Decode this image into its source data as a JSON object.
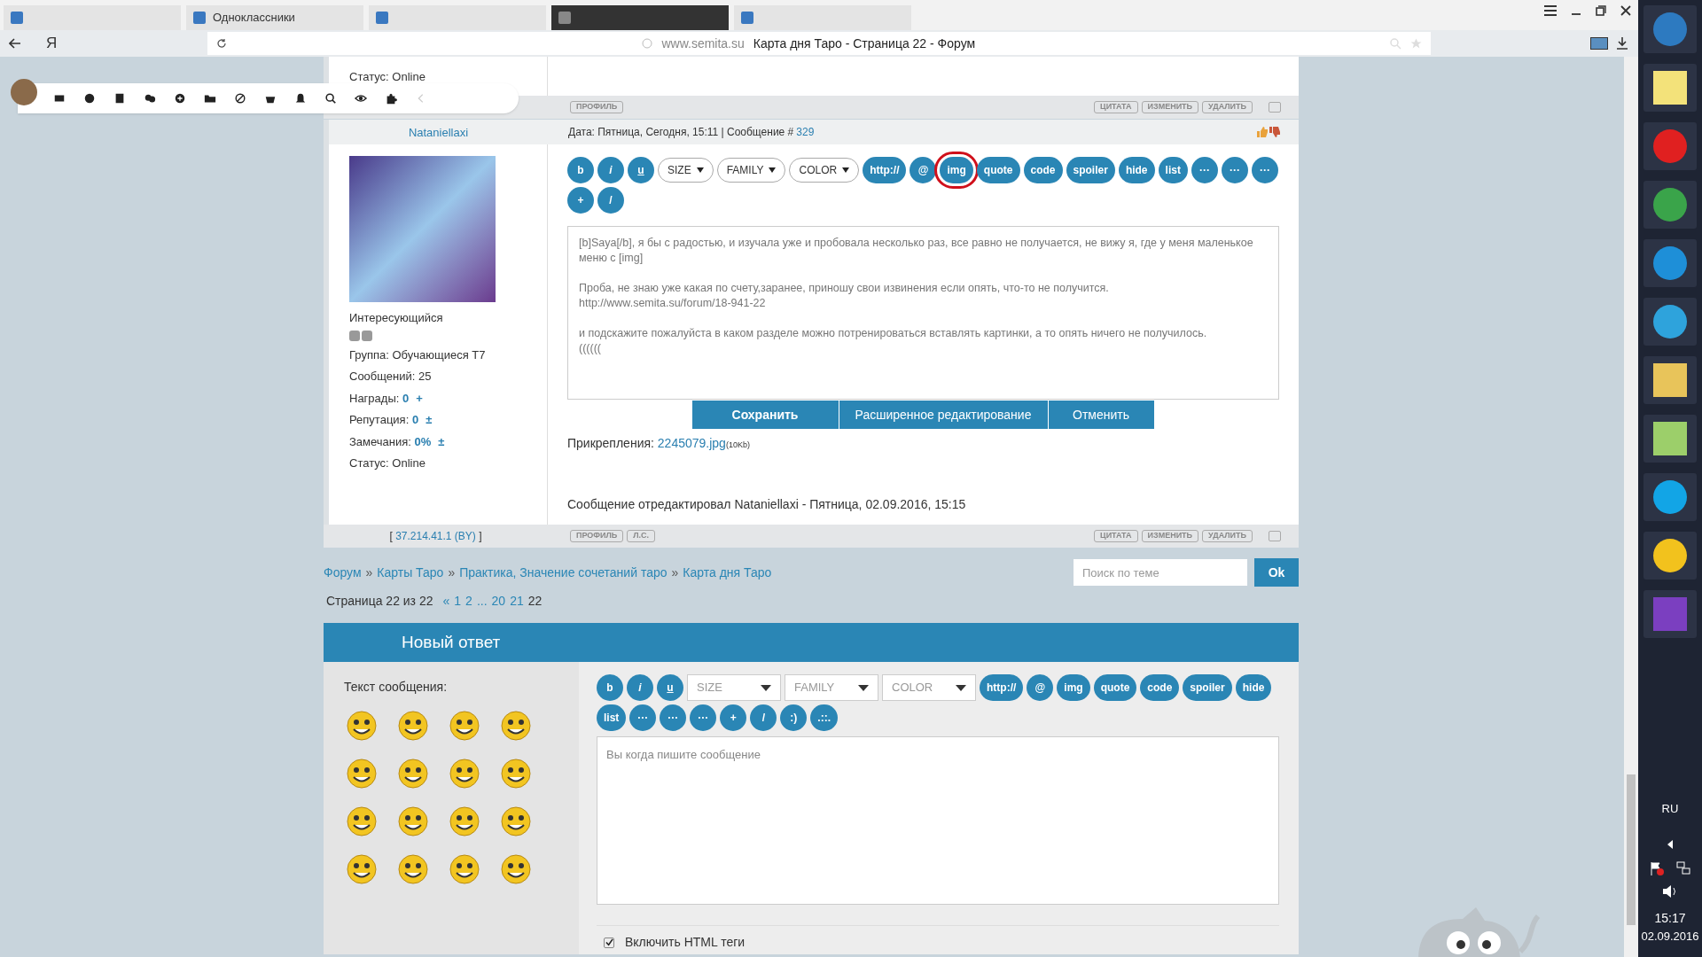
{
  "browser": {
    "tabs": [
      {
        "selected": false
      },
      {
        "label": "Одноклассники",
        "selected": false
      },
      {
        "selected": false
      },
      {
        "selected": true
      },
      {
        "selected": false
      }
    ],
    "logo": "Я",
    "url": "www.semita.su",
    "page_title": "Карта дня Таро - Страница 22 - Форум"
  },
  "previous_post": {
    "status": "Статус: Online",
    "footer_left": [
      "ПРОФИЛЬ"
    ],
    "footer_right": [
      "ЦИТАТА",
      "ИЗМЕНИТЬ",
      "УДАЛИТЬ"
    ]
  },
  "post": {
    "author": "Nataniellaxi",
    "date": "Дата: Пятница, Сегодня, 15:11 | Сообщение # ",
    "number": "329",
    "rank": "Интересующийся",
    "stats": [
      {
        "label": "Группа: ",
        "value": "Обучающиеся Т7",
        "kind": "plain"
      },
      {
        "label": "Сообщений: ",
        "value": "25",
        "kind": "plain"
      },
      {
        "label": "Награды: ",
        "value": "0",
        "kind": "link",
        "action": "+"
      },
      {
        "label": "Репутация: ",
        "value": "0",
        "kind": "link",
        "action": "±"
      },
      {
        "label": "Замечания: ",
        "value": "0%",
        "kind": "link",
        "action": "±"
      },
      {
        "label": "Статус: ",
        "value": "Online",
        "kind": "plain"
      }
    ],
    "toolbar": [
      {
        "label": "b",
        "kind": "button",
        "highlighted": false
      },
      {
        "label": "i",
        "kind": "button",
        "highlighted": false
      },
      {
        "label": "u",
        "kind": "button",
        "highlighted": false
      },
      {
        "label": "SIZE",
        "kind": "dropdown"
      },
      {
        "label": "FAMILY",
        "kind": "dropdown"
      },
      {
        "label": "COLOR",
        "kind": "dropdown"
      },
      {
        "label": "http://",
        "kind": "button",
        "highlighted": false
      },
      {
        "label": "@",
        "kind": "button",
        "highlighted": false
      },
      {
        "label": "img",
        "kind": "button",
        "highlighted": true
      },
      {
        "label": "quote",
        "kind": "button",
        "highlighted": false
      },
      {
        "label": "code",
        "kind": "button",
        "highlighted": false
      },
      {
        "label": "spoiler",
        "kind": "button",
        "highlighted": false
      },
      {
        "label": "hide",
        "kind": "button",
        "highlighted": false
      },
      {
        "label": "list",
        "kind": "button",
        "highlighted": false
      },
      {
        "label": "···",
        "kind": "button",
        "highlighted": false
      },
      {
        "label": "···",
        "kind": "button",
        "highlighted": false
      },
      {
        "label": "···",
        "kind": "button",
        "highlighted": false
      },
      {
        "label": "+",
        "kind": "button",
        "highlighted": false
      },
      {
        "label": "/",
        "kind": "button",
        "highlighted": false
      }
    ],
    "text": [
      "[b]Saya[/b], я бы с радостью, и изучала уже и пробовала несколько раз, все равно не получается, не вижу я, где у меня маленькое меню с [img]",
      "Проба, не знаю уже какая по счету,заранее, приношу свои извинения если опять, что-то не получится.\nhttp://www.semita.su/forum/18-941-22",
      "и подскажите пожалуйста в каком разделе можно потренироваться вставлять картинки, а то опять ничего не получилось.\n(((((("
    ],
    "actions": [
      "Сохранить",
      "Расширенное редактирование",
      "Отменить"
    ],
    "attachments_label": "Прикрепления: ",
    "attachment": "2245079.jpg",
    "attachment_size": "(10Kb)",
    "edit_note": "Сообщение отредактировал Nataniellaxi - Пятница, 02.09.2016, 15:15",
    "ip_open": "[",
    "ip": "37.214.41.1",
    "ip_close": "]",
    "country": "(BY)",
    "footer_left": [
      "ПРОФИЛЬ",
      "Л.С."
    ],
    "footer_right": [
      "ЦИТАТА",
      "ИЗМЕНИТЬ",
      "УДАЛИТЬ"
    ]
  },
  "breadcrumb": [
    {
      "kind": "link",
      "text": "Форум"
    },
    {
      "kind": "sep",
      "text": "»"
    },
    {
      "kind": "link",
      "text": "Карты Таро"
    },
    {
      "kind": "sep",
      "text": "»"
    },
    {
      "kind": "link",
      "text": "Практика, Значение сочетаний таро"
    },
    {
      "kind": "sep",
      "text": "»"
    },
    {
      "kind": "link",
      "text": "Карта дня Таро"
    }
  ],
  "search": {
    "placeholder": "Поиск по теме",
    "button": "Ok"
  },
  "pagination": {
    "label": "Страница 22 из 22",
    "pages": [
      {
        "text": "«",
        "selected": false
      },
      {
        "text": "1",
        "selected": false
      },
      {
        "text": "2",
        "selected": false
      },
      {
        "text": "...",
        "selected": false
      },
      {
        "text": "20",
        "selected": false
      },
      {
        "text": "21",
        "selected": false
      },
      {
        "text": "22",
        "selected": true
      }
    ]
  },
  "new_reply": {
    "title": "Новый ответ",
    "label": "Текст сообщения:",
    "toolbar": [
      {
        "label": "b",
        "kind": "button"
      },
      {
        "label": "i",
        "kind": "button"
      },
      {
        "label": "u",
        "kind": "button"
      },
      {
        "label": "SIZE",
        "kind": "select"
      },
      {
        "label": "FAMILY",
        "kind": "select"
      },
      {
        "label": "COLOR",
        "kind": "select"
      },
      {
        "label": "http://",
        "kind": "button"
      },
      {
        "label": "@",
        "kind": "button"
      },
      {
        "label": "img",
        "kind": "button"
      },
      {
        "label": "quote",
        "kind": "button"
      },
      {
        "label": "code",
        "kind": "button"
      },
      {
        "label": "spoiler",
        "kind": "button"
      },
      {
        "label": "hide",
        "kind": "button"
      },
      {
        "label": "list",
        "kind": "button"
      },
      {
        "label": "···",
        "kind": "button"
      },
      {
        "label": "···",
        "kind": "button"
      },
      {
        "label": "···",
        "kind": "button"
      },
      {
        "label": "+",
        "kind": "button"
      },
      {
        "label": "/",
        "kind": "button"
      },
      {
        "label": ":)",
        "kind": "button"
      },
      {
        "label": ".::.",
        "kind": "button"
      }
    ],
    "placeholder": "Вы когда пишите сообщение",
    "html_tags": {
      "label": "Включить HTML теги",
      "checked": true
    }
  },
  "taskbar": {
    "language": "RU",
    "time": "15:17",
    "date": "02.09.2016"
  }
}
